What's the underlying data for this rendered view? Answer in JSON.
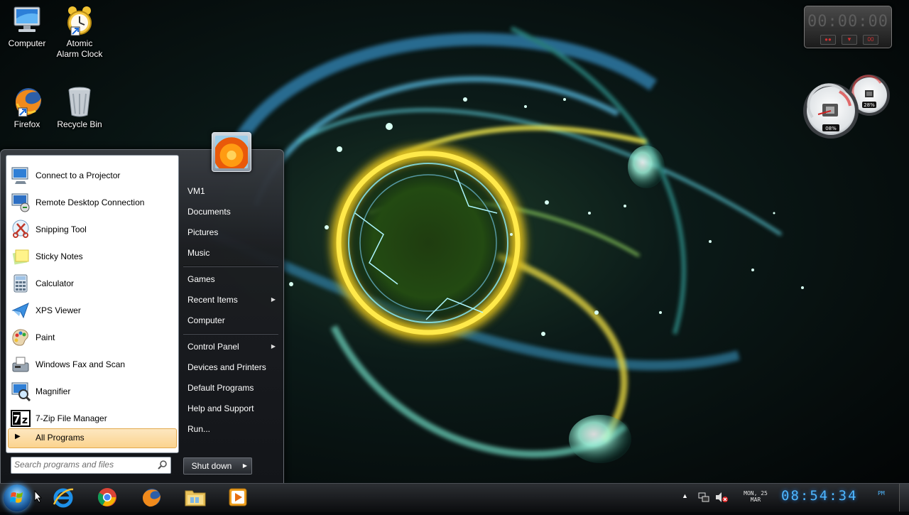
{
  "desktop": {
    "icons": [
      {
        "label": "Computer",
        "icon": "computer-icon"
      },
      {
        "label": "Atomic Alarm Clock",
        "label_line1": "Atomic",
        "label_line2": "Alarm Clock",
        "icon": "alarm-clock-icon"
      },
      {
        "label": "Firefox",
        "icon": "firefox-icon"
      },
      {
        "label": "Recycle Bin",
        "icon": "recycle-bin-icon"
      }
    ]
  },
  "gadgets": {
    "stopwatch": {
      "time": "00:00:00",
      "buttons": [
        "●●",
        "▼",
        "00"
      ]
    },
    "cpu_meter": {
      "cpu_label": "08%",
      "cpu_percent": 8,
      "ram_label": "28%",
      "ram_percent": 28
    }
  },
  "start_menu": {
    "programs": [
      {
        "label": "Connect to a Projector",
        "icon": "projector-icon"
      },
      {
        "label": "Remote Desktop Connection",
        "icon": "remote-desktop-icon"
      },
      {
        "label": "Snipping Tool",
        "icon": "scissors-icon"
      },
      {
        "label": "Sticky Notes",
        "icon": "sticky-notes-icon"
      },
      {
        "label": "Calculator",
        "icon": "calculator-icon"
      },
      {
        "label": "XPS Viewer",
        "icon": "xps-viewer-icon"
      },
      {
        "label": "Paint",
        "icon": "paint-palette-icon"
      },
      {
        "label": "Windows Fax and Scan",
        "icon": "fax-icon"
      },
      {
        "label": "Magnifier",
        "icon": "magnifier-icon"
      },
      {
        "label": "7-Zip File Manager",
        "icon": "7zip-icon"
      }
    ],
    "all_programs": "All Programs",
    "search_placeholder": "Search programs and files",
    "user_name": "VM1",
    "right_links": {
      "group1": [
        "VM1",
        "Documents",
        "Pictures",
        "Music"
      ],
      "group2": [
        "Games",
        "Recent Items",
        "Computer"
      ],
      "group3": [
        "Control Panel",
        "Devices and Printers",
        "Default Programs",
        "Help and Support",
        "Run..."
      ]
    },
    "shutdown_label": "Shut down"
  },
  "taskbar": {
    "pinned": [
      "internet-explorer-icon",
      "chrome-icon",
      "firefox-icon",
      "windows-explorer-icon",
      "media-player-icon"
    ],
    "clock": {
      "date_line1": "MON, 25",
      "date_line2": "MAR",
      "time": "08:54:34",
      "ampm": "PM"
    }
  },
  "colors": {
    "clock_blue": "#4fb7ff",
    "all_programs_highlight": "#fbd38e"
  }
}
